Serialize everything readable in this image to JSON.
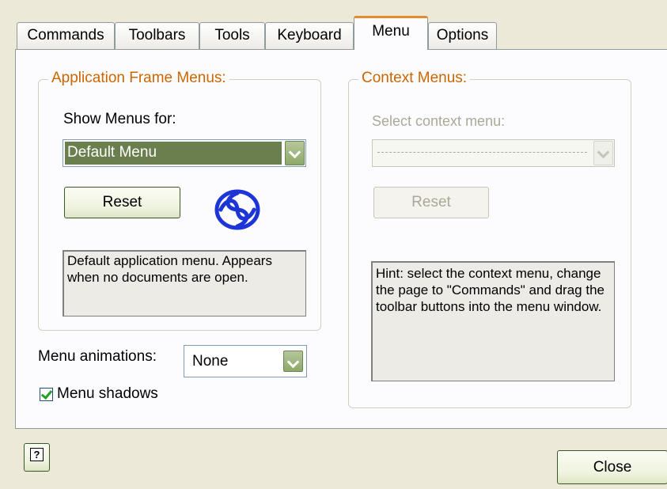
{
  "tabs": [
    {
      "label": "Commands"
    },
    {
      "label": "Toolbars"
    },
    {
      "label": "Tools"
    },
    {
      "label": "Keyboard"
    },
    {
      "label": "Menu"
    },
    {
      "label": "Options"
    }
  ],
  "active_tab": "Menu",
  "app_menus": {
    "legend": "Application Frame Menus:",
    "show_label": "Show Menus for:",
    "selected": "Default Menu",
    "reset_label": "Reset",
    "icon": "menu-swirl-icon",
    "description": "Default application menu. Appears when no documents are open."
  },
  "context_menus": {
    "legend": "Context Menus:",
    "select_label": "Select context menu:",
    "reset_label": "Reset",
    "hint": "Hint: select the context menu, change the page to \"Commands\" and drag the toolbar buttons into the menu window."
  },
  "menu_animations": {
    "label": "Menu animations:",
    "value": "None"
  },
  "menu_shadows": {
    "label": "Menu shadows",
    "checked": true
  },
  "footer": {
    "help_icon": "help-icon",
    "close_label": "Close"
  },
  "colors": {
    "dialog_bg": "#ece9d8",
    "accent_orange": "#e68b2c",
    "legend_text": "#cc6600",
    "selection_bg": "#6b7f4e"
  }
}
